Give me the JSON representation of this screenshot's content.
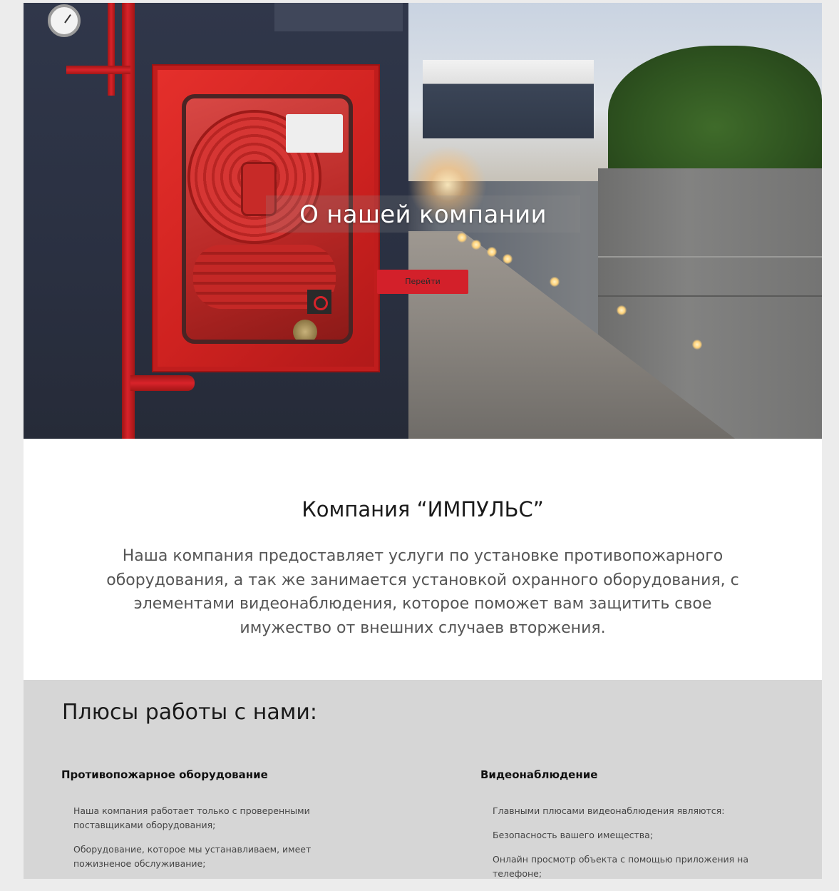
{
  "hero": {
    "title": "О нашей компании",
    "button_label": "Перейти"
  },
  "about": {
    "title": "Компания “ИМПУЛЬС”",
    "text": "Наша компания предоставляет услуги по установке противопожарного оборудования, а так же занимается установкой охранного оборудования, с элементами видеонаблюдения, которое поможет вам защитить свое имужество от внешних случаев вторжения."
  },
  "advantages": {
    "title": "Плюсы работы с нами:",
    "columns": [
      {
        "title": "Противопожарное оборудование",
        "items": [
          "Наша компания работает только с проверенными поставщиками оборудования;",
          "Оборудование, которое мы устанавливаем, имеет пожизненое обслуживание;"
        ]
      },
      {
        "title": "Видеонаблюдение",
        "items": [
          "Главными плюсами видеонаблюдения являются:",
          "Безопасность вашего имещества;",
          "Онлайн просмотр объекта с помощью приложения на телефоне;"
        ]
      }
    ]
  },
  "colors": {
    "accent": "#d3202a",
    "page_bg": "#ececec",
    "advantages_bg": "#d6d6d6"
  }
}
